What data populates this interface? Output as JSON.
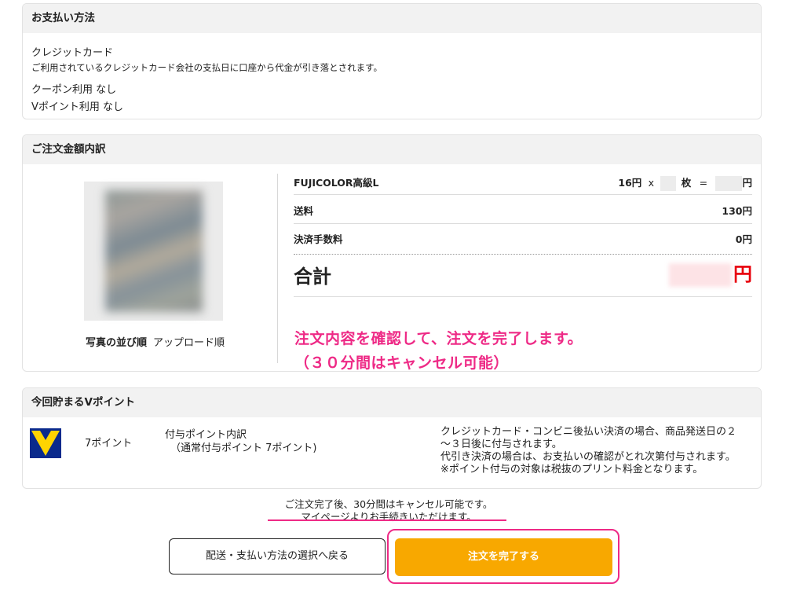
{
  "payment": {
    "header": "お支払い方法",
    "method": "クレジットカード",
    "method_note": "ご利用されているクレジットカード会社の支払日に口座から代金が引き落とされます。",
    "coupon": "クーポン利用 なし",
    "vpoint_use": "Vポイント利用 なし"
  },
  "breakdown": {
    "header": "ご注文金額内訳",
    "photo_order_label": "写真の並び順",
    "photo_order_value": "アップロード順",
    "product_name": "FUJICOLOR高級L",
    "unit_price": "16円",
    "times": "x",
    "sheets_unit": "枚",
    "equals": "=",
    "yen": "円",
    "shipping_label": "送料",
    "shipping_value": "130円",
    "fee_label": "決済手数料",
    "fee_value": "0円",
    "total_label": "合計",
    "total_yen": "円",
    "annotation_line1": "注文内容を確認して、注文を完了します。",
    "annotation_line2": "（３０分間はキャンセル可能）"
  },
  "points": {
    "header": "今回貯まるVポイント",
    "amount": "7ポイント",
    "detail_title": "付与ポイント内訳",
    "detail_value": "（通常付与ポイント 7ポイント)",
    "note1": "クレジットカード・コンビニ後払い決済の場合、商品発送日の２",
    "note2": "～３日後に付与されます。",
    "note3": "代引き決済の場合は、お支払いの確認がとれ次第付与されます。",
    "note4": "※ポイント付与の対象は税抜のプリント料金となります。"
  },
  "notice": {
    "line1": "ご注文完了後、30分間はキャンセル可能です。",
    "line2": "マイページよりお手続きいただけます。"
  },
  "buttons": {
    "back_label": "配送・支払い方法の選択へ戻る",
    "complete_label": "注文を完了する"
  },
  "colors": {
    "accent_pink": "#ee2a86",
    "complete_orange": "#f8a800",
    "total_red": "#e8000b",
    "tpoint_blue": "#0a2a8c",
    "tpoint_yellow": "#ffd400"
  }
}
